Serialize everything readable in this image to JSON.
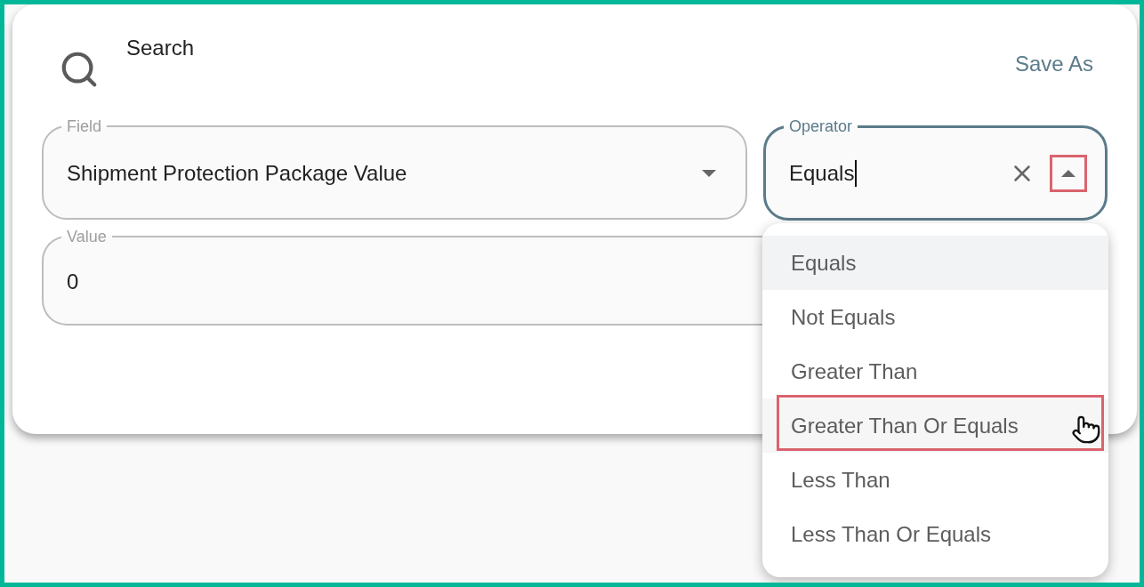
{
  "dialog": {
    "title": "Search",
    "save_as_button": "Save As",
    "fields": [
      {
        "kind": "select",
        "label": "Field",
        "value": "Shipment Protection Package Value",
        "focused": false,
        "expanded": false
      },
      {
        "kind": "combobox",
        "label": "Operator",
        "value": "Equals",
        "focused": true,
        "expanded": true,
        "toggle_highlighted": true
      },
      {
        "kind": "text",
        "label": "Value",
        "value": "0",
        "focused": false
      }
    ]
  },
  "dropdown": {
    "options": [
      {
        "label": "Equals",
        "selected": true,
        "hovered": false,
        "highlighted": false
      },
      {
        "label": "Not Equals",
        "selected": false,
        "hovered": false,
        "highlighted": false
      },
      {
        "label": "Greater Than",
        "selected": false,
        "hovered": false,
        "highlighted": false
      },
      {
        "label": "Greater Than Or Equals",
        "selected": false,
        "hovered": true,
        "highlighted": true
      },
      {
        "label": "Less Than",
        "selected": false,
        "hovered": false,
        "highlighted": false
      },
      {
        "label": "Less Than Or Equals",
        "selected": false,
        "hovered": false,
        "highlighted": false
      }
    ]
  }
}
